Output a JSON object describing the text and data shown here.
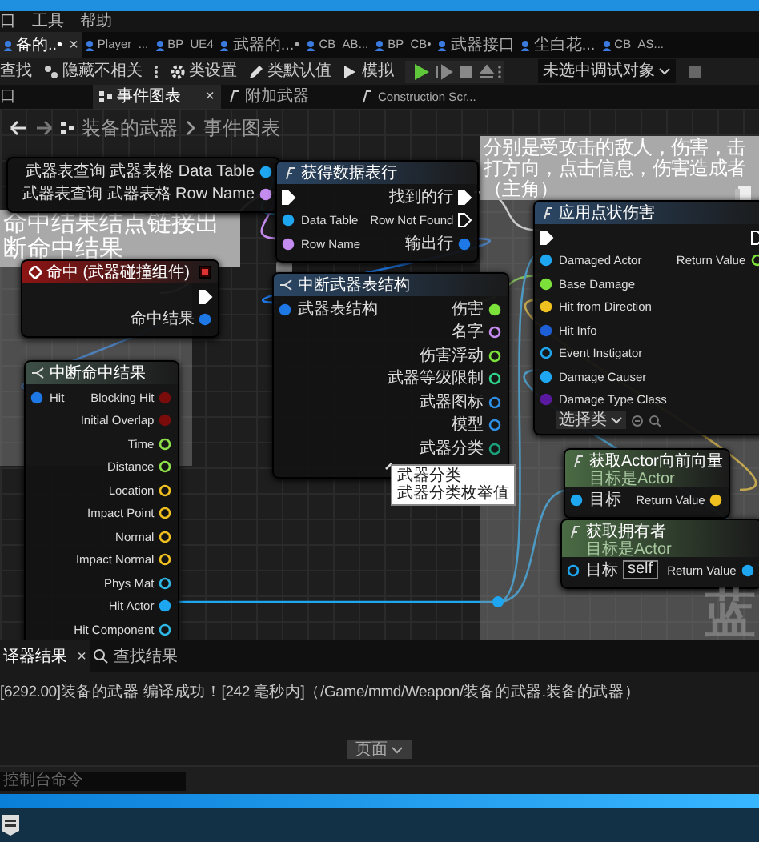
{
  "menu": [
    "口",
    "工具",
    "帮助"
  ],
  "tabs": [
    {
      "label": "备的..•",
      "selected": true,
      "close": "×"
    },
    {
      "label": "Player_...",
      "selected": false
    },
    {
      "label": "BP_UE4",
      "selected": false
    },
    {
      "label": "武器的...•",
      "selected": false
    },
    {
      "label": "CB_AB...",
      "selected": false
    },
    {
      "label": "BP_CB•",
      "selected": false
    },
    {
      "label": "武器接口",
      "selected": false
    },
    {
      "label": "尘白花...",
      "selected": false
    },
    {
      "label": "CB_AS...",
      "selected": false
    }
  ],
  "toolbar": {
    "find": "查找",
    "hide_unrelated": "隐藏不相关",
    "class_settings": "类设置",
    "class_defaults": "类默认值",
    "simulate": "模拟",
    "debug_target": "未选中调试对象"
  },
  "graph_tabs": {
    "panel_label": "口",
    "tabs": [
      {
        "label": "事件图表",
        "selected": true,
        "close": "×"
      },
      {
        "label": "附加武器",
        "selected": false
      },
      {
        "label": "Construction Scr...",
        "selected": false
      }
    ]
  },
  "breadcrumb": [
    "装备的武器",
    "事件图表"
  ],
  "comments": [
    {
      "lines": [
        "命中结果结点链接出",
        "断命中结果"
      ]
    },
    {
      "lines": [
        "分别是受攻击的敌人，伤害，击",
        "打方向，点击信息，伤害造成者",
        "（主角）"
      ]
    }
  ],
  "nodes": [
    {
      "kind": "getter",
      "outputs": [
        {
          "label": "武器表查询 武器表格 Data Table",
          "kind": "data",
          "color": "#1ea7f0",
          "connected": true
        },
        {
          "label": "武器表查询 武器表格 Row Name",
          "kind": "data",
          "color": "#c58cf0",
          "connected": true
        }
      ]
    },
    {
      "kind": "event",
      "title": "命中 (武器碰撞组件)",
      "color": "#8c1414",
      "outputs": [
        {
          "kind": "exec",
          "connected": true
        },
        {
          "label": "命中结果",
          "kind": "data",
          "color": "#1e78e6",
          "connected": true
        }
      ]
    },
    {
      "kind": "break",
      "title": "中断命中结果",
      "color": "#3d4f47",
      "inputs": [
        {
          "label": "Hit",
          "kind": "data",
          "color": "#1e78e6",
          "connected": true
        }
      ],
      "outputs": [
        {
          "label": "Blocking Hit",
          "kind": "data",
          "color": "#7a0c0c",
          "connected": true
        },
        {
          "label": "Initial Overlap",
          "kind": "data",
          "color": "#7a0c0c",
          "connected": true
        },
        {
          "label": "Time",
          "kind": "data",
          "color": "#8ee04a",
          "connected": false
        },
        {
          "label": "Distance",
          "kind": "data",
          "color": "#8ee04a",
          "connected": false
        },
        {
          "label": "Location",
          "kind": "data",
          "color": "#f0c020",
          "connected": false
        },
        {
          "label": "Impact Point",
          "kind": "data",
          "color": "#f0c020",
          "connected": false
        },
        {
          "label": "Normal",
          "kind": "data",
          "color": "#f0c020",
          "connected": false
        },
        {
          "label": "Impact Normal",
          "kind": "data",
          "color": "#f0c020",
          "connected": false
        },
        {
          "label": "Phys Mat",
          "kind": "data",
          "color": "#2fb8e6",
          "connected": false
        },
        {
          "label": "Hit Actor",
          "kind": "data",
          "color": "#1ea7f0",
          "connected": true
        },
        {
          "label": "Hit Component",
          "kind": "data",
          "color": "#2fb8e6",
          "connected": false
        }
      ]
    },
    {
      "kind": "function",
      "title": "获得数据表行",
      "color": "#2b4766",
      "inputs": [
        {
          "kind": "exec",
          "connected": true
        },
        {
          "label": "Data Table",
          "kind": "data",
          "color": "#1ea7f0",
          "connected": true
        },
        {
          "label": "Row Name",
          "kind": "data",
          "color": "#c58cf0",
          "connected": true
        }
      ],
      "outputs": [
        {
          "label": "找到的行",
          "kind": "exec",
          "connected": true
        },
        {
          "label": "Row Not Found",
          "kind": "exec",
          "connected": false
        },
        {
          "label": "输出行",
          "kind": "data",
          "color": "#1e78e6",
          "connected": true
        }
      ]
    },
    {
      "kind": "break",
      "title": "中断武器表结构",
      "color": "#2b4766",
      "inputs": [
        {
          "label": "武器表结构",
          "kind": "data",
          "color": "#1e78e6",
          "connected": true
        }
      ],
      "outputs": [
        {
          "label": "伤害",
          "kind": "data",
          "color": "#7ce23b",
          "connected": true
        },
        {
          "label": "名字",
          "kind": "data",
          "color": "#c58cf0",
          "connected": false
        },
        {
          "label": "伤害浮动",
          "kind": "data",
          "color": "#7ce23b",
          "connected": false
        },
        {
          "label": "武器等级限制",
          "kind": "data",
          "color": "#2fd38a",
          "connected": false
        },
        {
          "label": "武器图标",
          "kind": "data",
          "color": "#2f8fe6",
          "connected": false
        },
        {
          "label": "模型",
          "kind": "data",
          "color": "#2f8fe6",
          "connected": false
        },
        {
          "label": "武器分类",
          "kind": "data",
          "color": "#1aa07a",
          "connected": false
        }
      ]
    },
    {
      "kind": "function",
      "title": "应用点状伤害",
      "color": "#2b4766",
      "inputs": [
        {
          "kind": "exec",
          "connected": true
        },
        {
          "label": "Damaged Actor",
          "kind": "data",
          "color": "#1ea7f0",
          "connected": true
        },
        {
          "label": "Base Damage",
          "kind": "data",
          "color": "#7ce23b",
          "connected": true
        },
        {
          "label": "Hit from Direction",
          "kind": "data",
          "color": "#f0c020",
          "connected": true
        },
        {
          "label": "Hit Info",
          "kind": "data",
          "color": "#1e5fd6",
          "connected": true
        },
        {
          "label": "Event Instigator",
          "kind": "data",
          "color": "#1ea7f0",
          "connected": false
        },
        {
          "label": "Damage Causer",
          "kind": "data",
          "color": "#1ea7f0",
          "connected": true
        },
        {
          "label": "Damage Type Class",
          "kind": "data",
          "color": "#5a1aa0",
          "connected": true,
          "dropdown": "选择类"
        }
      ],
      "outputs": [
        {
          "kind": "exec",
          "connected": false
        },
        {
          "label": "Return Value",
          "kind": "data",
          "color": "#7ce23b",
          "connected": false
        }
      ]
    },
    {
      "kind": "function",
      "title": "获取Actor向前向量",
      "subtitle": "目标是Actor",
      "color": "#4a6b44",
      "inputs": [
        {
          "label": "目标",
          "kind": "data",
          "color": "#1ea7f0",
          "connected": true
        }
      ],
      "outputs": [
        {
          "label": "Return Value",
          "kind": "data",
          "color": "#f0c020",
          "connected": true
        }
      ]
    },
    {
      "kind": "function",
      "title": "获取拥有者",
      "subtitle": "目标是Actor",
      "color": "#4a6b44",
      "inputs": [
        {
          "label": "目标",
          "kind": "data",
          "color": "#1ea7f0",
          "connected": false,
          "value": "self"
        }
      ],
      "outputs": [
        {
          "label": "Return Value",
          "kind": "data",
          "color": "#1ea7f0",
          "connected": true
        }
      ]
    }
  ],
  "tooltip": [
    "武器分类",
    "武器分类枚举值"
  ],
  "graph_label": "蓝",
  "bottom_tabs": [
    {
      "label": "译器结果",
      "selected": true,
      "close": "×"
    },
    {
      "label": "查找结果",
      "selected": false
    }
  ],
  "log": [
    "[6292.00]装备的武器 编译成功！[242 毫秒内]（/Game/mmd/Weapon/装备的武器.装备的武器）"
  ],
  "page_button": "页面",
  "console": {
    "placeholder": "控制台命令"
  }
}
